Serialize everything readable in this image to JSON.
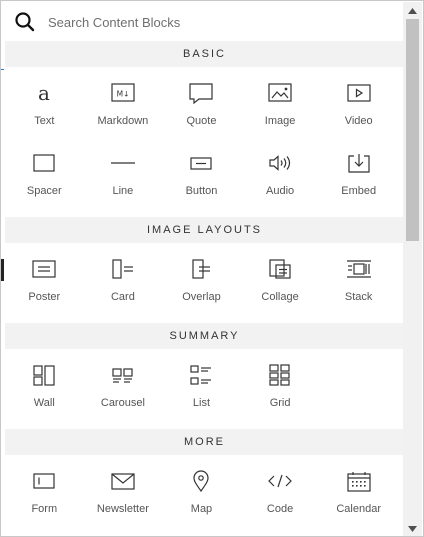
{
  "search": {
    "placeholder": "Search Content Blocks",
    "icon": "search-icon"
  },
  "sections": [
    {
      "title": "BASIC",
      "blocks": [
        {
          "label": "Text",
          "icon": "text-icon"
        },
        {
          "label": "Markdown",
          "icon": "markdown-icon"
        },
        {
          "label": "Quote",
          "icon": "quote-icon"
        },
        {
          "label": "Image",
          "icon": "image-icon"
        },
        {
          "label": "Video",
          "icon": "video-icon"
        },
        {
          "label": "Spacer",
          "icon": "spacer-icon"
        },
        {
          "label": "Line",
          "icon": "line-icon"
        },
        {
          "label": "Button",
          "icon": "button-icon"
        },
        {
          "label": "Audio",
          "icon": "audio-icon"
        },
        {
          "label": "Embed",
          "icon": "embed-icon"
        }
      ]
    },
    {
      "title": "IMAGE LAYOUTS",
      "blocks": [
        {
          "label": "Poster",
          "icon": "poster-icon"
        },
        {
          "label": "Card",
          "icon": "card-icon"
        },
        {
          "label": "Overlap",
          "icon": "overlap-icon"
        },
        {
          "label": "Collage",
          "icon": "collage-icon"
        },
        {
          "label": "Stack",
          "icon": "stack-icon"
        }
      ]
    },
    {
      "title": "SUMMARY",
      "blocks": [
        {
          "label": "Wall",
          "icon": "wall-icon"
        },
        {
          "label": "Carousel",
          "icon": "carousel-icon"
        },
        {
          "label": "List",
          "icon": "list-icon"
        },
        {
          "label": "Grid",
          "icon": "grid-icon"
        }
      ]
    },
    {
      "title": "MORE",
      "blocks": [
        {
          "label": "Form",
          "icon": "form-icon"
        },
        {
          "label": "Newsletter",
          "icon": "newsletter-icon"
        },
        {
          "label": "Map",
          "icon": "map-icon"
        },
        {
          "label": "Code",
          "icon": "code-icon"
        },
        {
          "label": "Calendar",
          "icon": "calendar-icon"
        }
      ]
    }
  ],
  "colors": {
    "section_bg": "#f2f2f2",
    "icon": "#333333",
    "label": "#555555",
    "scroll_thumb": "#c1c1c1"
  }
}
